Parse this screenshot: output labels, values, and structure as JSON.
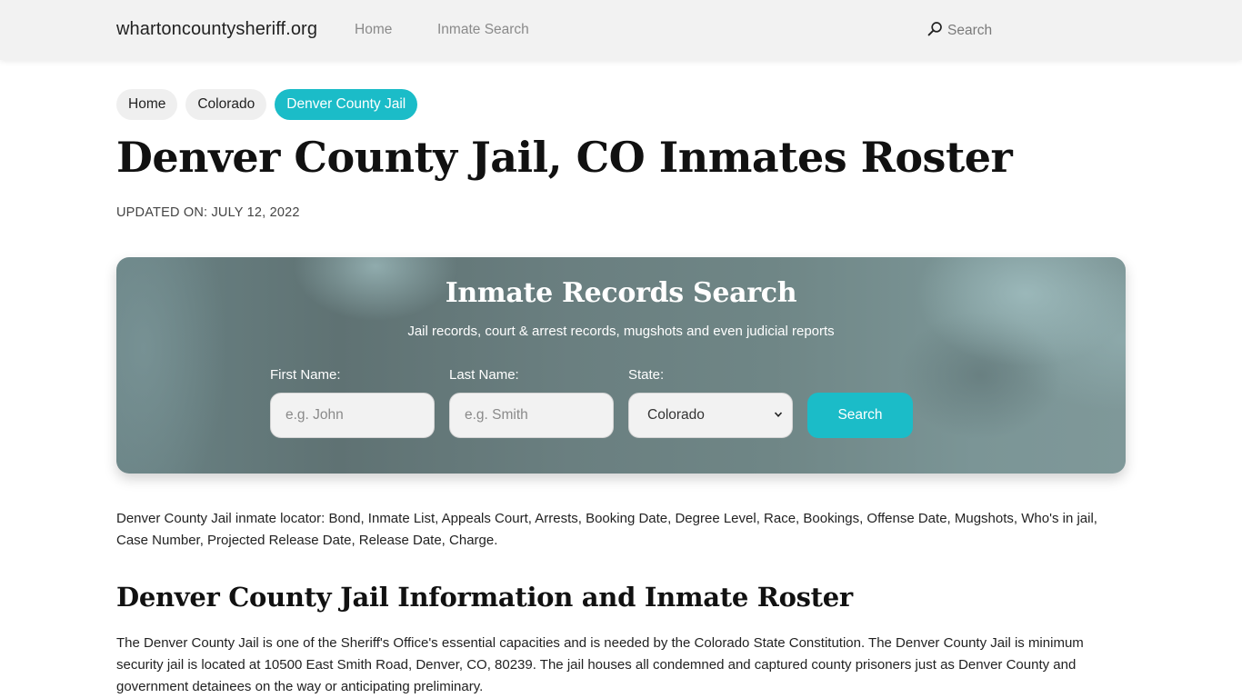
{
  "navbar": {
    "brand": "whartoncountysheriff.org",
    "links": [
      {
        "label": "Home"
      },
      {
        "label": "Inmate Search"
      }
    ],
    "search_label": "Search",
    "search_icon": "search-icon"
  },
  "breadcrumb": [
    {
      "label": "Home",
      "active": false
    },
    {
      "label": "Colorado",
      "active": false
    },
    {
      "label": "Denver County Jail",
      "active": true
    }
  ],
  "page": {
    "title": "Denver County Jail, CO Inmates Roster",
    "updated": "UPDATED ON: JULY 12, 2022"
  },
  "search_panel": {
    "title": "Inmate Records Search",
    "subtitle": "Jail records, court & arrest records, mugshots and even judicial reports",
    "first_name": {
      "label": "First Name:",
      "placeholder": "e.g. John",
      "value": ""
    },
    "last_name": {
      "label": "Last Name:",
      "placeholder": "e.g. Smith",
      "value": ""
    },
    "state": {
      "label": "State:",
      "selected": "Colorado"
    },
    "button_label": "Search"
  },
  "content": {
    "intro": "Denver County Jail inmate locator: Bond, Inmate List, Appeals Court, Arrests, Booking Date, Degree Level, Race, Bookings, Offense Date, Mugshots, Who's in jail, Case Number, Projected Release Date, Release Date, Charge.",
    "section_heading": "Denver County Jail Information and Inmate Roster",
    "section_body": "The Denver County Jail is one of the Sheriff's Office's essential capacities and is needed by the Colorado State Constitution. The Denver County Jail is minimum security jail is located at 10500 East Smith Road, Denver, CO, 80239. The jail houses all condemned and captured county prisoners just as Denver County and government detainees on the way or anticipating preliminary."
  },
  "colors": {
    "accent": "#1bbcc8",
    "navbar_bg": "#f2f2f2",
    "panel_base": "#6a8385"
  }
}
